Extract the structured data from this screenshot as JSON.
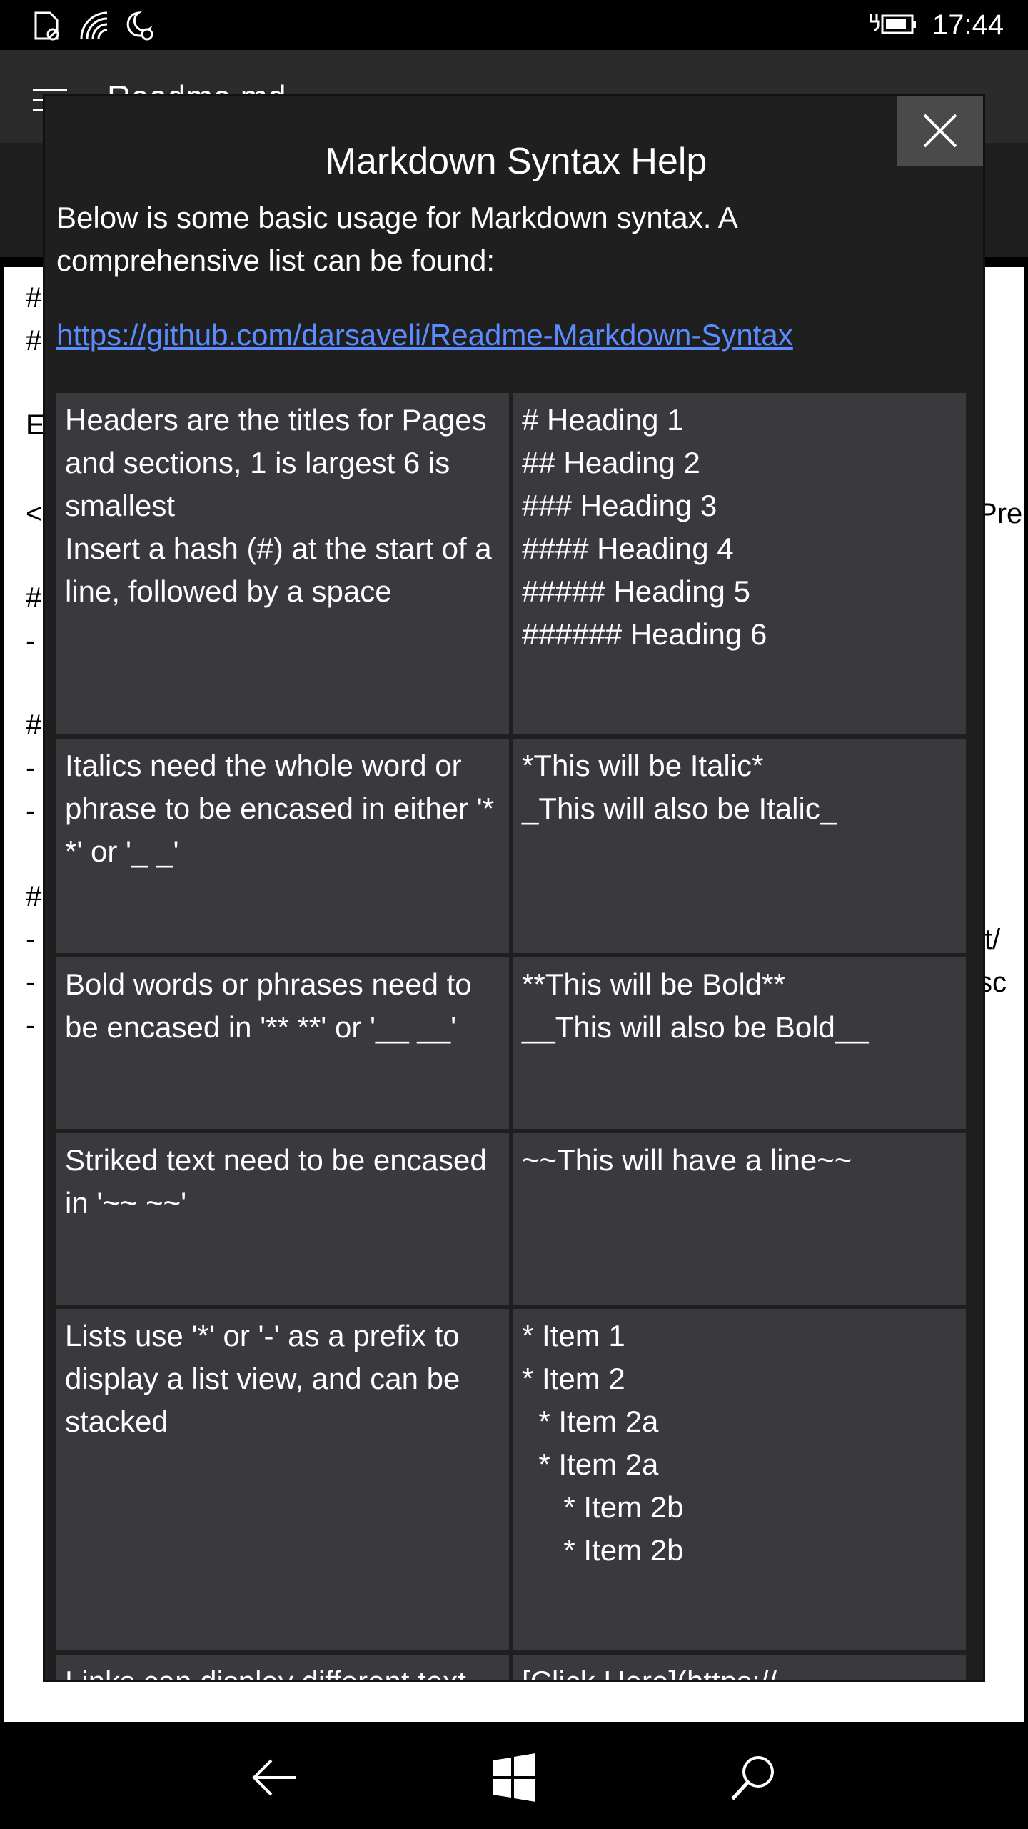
{
  "status_bar": {
    "time": "17:44",
    "icons": [
      "sim-icon",
      "wifi-icon",
      "quiet-hours-icon",
      "battery-charging-icon"
    ]
  },
  "app": {
    "title": "Readme.md",
    "editor_fragments": {
      "l1": "#",
      "l2": "#",
      "l3": "E",
      "l4": "<",
      "l4r": "Pre",
      "l5": "#",
      "l6": "-",
      "l7": "#",
      "l8": "-",
      "l9": "-",
      "l10": "#",
      "l11": "-",
      "l11r": "it/",
      "l12": "-",
      "l12r": "sc",
      "l13": "-"
    }
  },
  "dialog": {
    "title": "Markdown Syntax Help",
    "description": "Below is some basic usage for Markdown syntax. A comprehensive list can be found:",
    "link": "https://github.com/darsaveli/Readme-Markdown-Syntax",
    "rows": [
      {
        "description": "Headers are the titles for Pages and sections, 1 is largest 6 is smallest\nInsert a hash (#) at the start of a line, followed by a space",
        "example": "# Heading 1\n## Heading 2\n### Heading 3\n#### Heading 4\n##### Heading 5\n###### Heading 6"
      },
      {
        "description": "Italics need the whole word or phrase to be encased in either '* *' or '_ _'",
        "example": "*This will be Italic*\n_This will also be Italic_"
      },
      {
        "description": "Bold words or phrases need to be encased in '** **' or '__ __'",
        "example": "**This will be Bold**\n__This will also be Bold__"
      },
      {
        "description": "Striked text need to be encased in '~~ ~~'",
        "example": "~~This will have a line~~"
      },
      {
        "description": "Lists use '*' or '-' as a prefix to display a list view, and can be stacked",
        "example": "* Item 1\n* Item 2\n  * Item 2a\n  * Item 2a\n     * Item 2b\n     * Item 2b"
      },
      {
        "description": "Links can display different text",
        "example": "[Click Here](https://"
      }
    ]
  },
  "nav": {
    "icons": [
      "back-arrow-icon",
      "windows-start-icon",
      "search-icon"
    ]
  }
}
